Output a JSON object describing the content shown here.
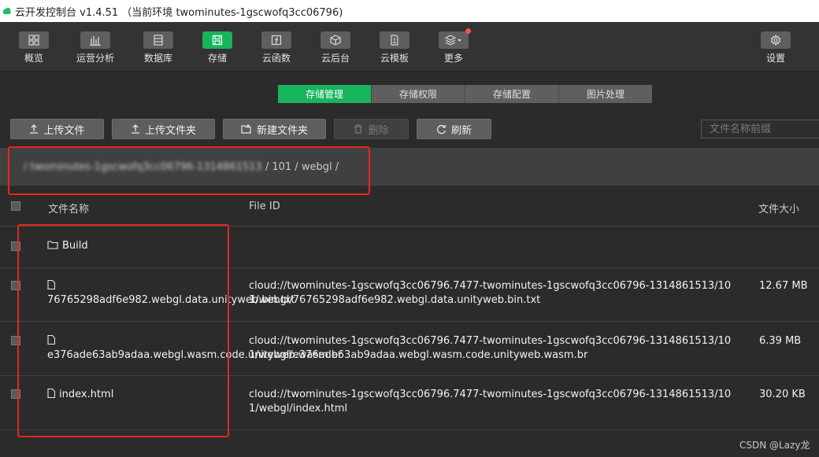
{
  "window": {
    "title": "云开发控制台 v1.4.51 （当前环境 twominutes-1gscwofq3cc06796)"
  },
  "toolbar": {
    "items": [
      {
        "label": "概览",
        "icon": "grid-icon"
      },
      {
        "label": "运营分析",
        "icon": "bar-chart-icon"
      },
      {
        "label": "数据库",
        "icon": "database-icon"
      },
      {
        "label": "存储",
        "icon": "storage-icon",
        "active": true
      },
      {
        "label": "云函数",
        "icon": "function-icon"
      },
      {
        "label": "云后台",
        "icon": "cube-icon"
      },
      {
        "label": "云模板",
        "icon": "template-icon"
      },
      {
        "label": "更多",
        "icon": "layers-icon",
        "badge": true
      },
      {
        "label": "设置",
        "icon": "gear-icon"
      }
    ]
  },
  "tabs": [
    "存储管理",
    "存储权限",
    "存储配置",
    "图片处理"
  ],
  "actions": {
    "upload_file": "上传文件",
    "upload_folder": "上传文件夹",
    "new_folder": "新建文件夹",
    "delete": "删除",
    "refresh": "刷新"
  },
  "search": {
    "placeholder": "文件名称前缀"
  },
  "breadcrumb": {
    "redacted": "/ twominutes-1gscwofq3cc06796-1314861513",
    "visible": "/ 101 / webgl /"
  },
  "table": {
    "headers": {
      "name": "文件名称",
      "file_id": "File ID",
      "size": "文件大小"
    },
    "rows": [
      {
        "type": "folder",
        "name": "Build",
        "file_id": "",
        "size": ""
      },
      {
        "type": "file",
        "name": "76765298adf6e982.webgl.data.unityweb.bin.txt",
        "file_id": "cloud://twominutes-1gscwofq3cc06796.7477-twominutes-1gscwofq3cc06796-1314861513/101/webgl/76765298adf6e982.webgl.data.unityweb.bin.txt",
        "size": "12.67 MB"
      },
      {
        "type": "file",
        "name": "e376ade63ab9adaa.webgl.wasm.code.unityweb.wasm.br",
        "file_id": "cloud://twominutes-1gscwofq3cc06796.7477-twominutes-1gscwofq3cc06796-1314861513/101/webgl/e376ade63ab9adaa.webgl.wasm.code.unityweb.wasm.br",
        "size": "6.39 MB"
      },
      {
        "type": "file",
        "name": "index.html",
        "file_id": "cloud://twominutes-1gscwofq3cc06796.7477-twominutes-1gscwofq3cc06796-1314861513/101/webgl/index.html",
        "size": "30.20 KB"
      }
    ]
  },
  "watermark": "CSDN @Lazy龙",
  "colors": {
    "accent": "#17b35d",
    "annotation": "#e8261f",
    "badge": "#ff4d4f"
  }
}
